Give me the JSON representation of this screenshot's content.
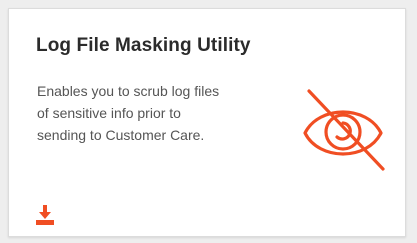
{
  "card": {
    "title": "Log File Masking Utility",
    "description_lines": [
      "Enables you to scrub log files",
      "of sensitive info prior to",
      "sending to Customer Care."
    ],
    "hero_icon": "eye-slash-icon",
    "action_icon": "download-icon"
  },
  "colors": {
    "accent": "#f04e23",
    "title": "#2b2b2b",
    "text": "#555555",
    "card_bg": "#ffffff",
    "page_bg": "#eeeeee"
  }
}
